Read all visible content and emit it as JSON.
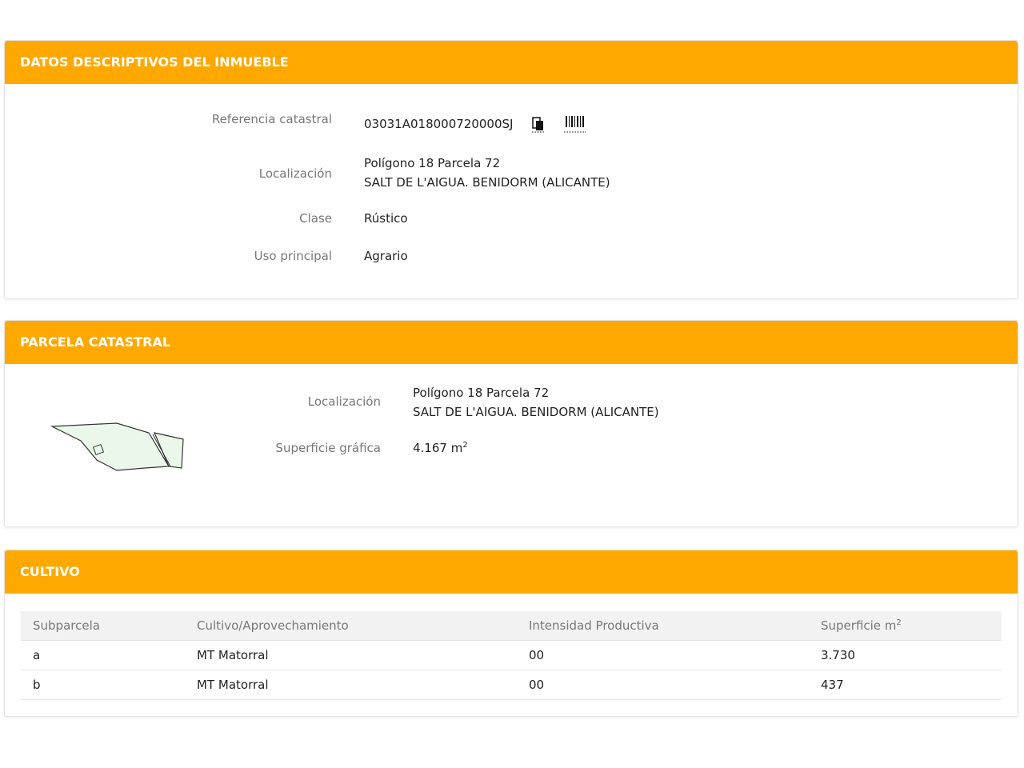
{
  "descriptivos": {
    "title": "DATOS DESCRIPTIVOS DEL INMUEBLE",
    "ref_label": "Referencia catastral",
    "ref_value": "03031A018000720000SJ",
    "loc_label": "Localización",
    "loc_line1": "Polígono 18 Parcela 72",
    "loc_line2": "SALT DE L'AIGUA. BENIDORM (ALICANTE)",
    "clase_label": "Clase",
    "clase_value": "Rústico",
    "uso_label": "Uso principal",
    "uso_value": "Agrario"
  },
  "parcela": {
    "title": "PARCELA CATASTRAL",
    "loc_label": "Localización",
    "loc_line1": "Polígono 18 Parcela 72",
    "loc_line2": "SALT DE L'AIGUA. BENIDORM (ALICANTE)",
    "sup_label": "Superficie gráfica",
    "sup_value": "4.167 m",
    "sup_exp": "2"
  },
  "cultivo": {
    "title": "CULTIVO",
    "headers": [
      "Subparcela",
      "Cultivo/Aprovechamiento",
      "Intensidad Productiva",
      "Superficie m"
    ],
    "header_exp": "2",
    "rows": [
      [
        "a",
        "MT Matorral",
        "00",
        "3.730"
      ],
      [
        "b",
        "MT Matorral",
        "00",
        "437"
      ]
    ]
  },
  "colors": {
    "accent": "#ffa800",
    "parcel_fill": "#eaf7ea"
  }
}
